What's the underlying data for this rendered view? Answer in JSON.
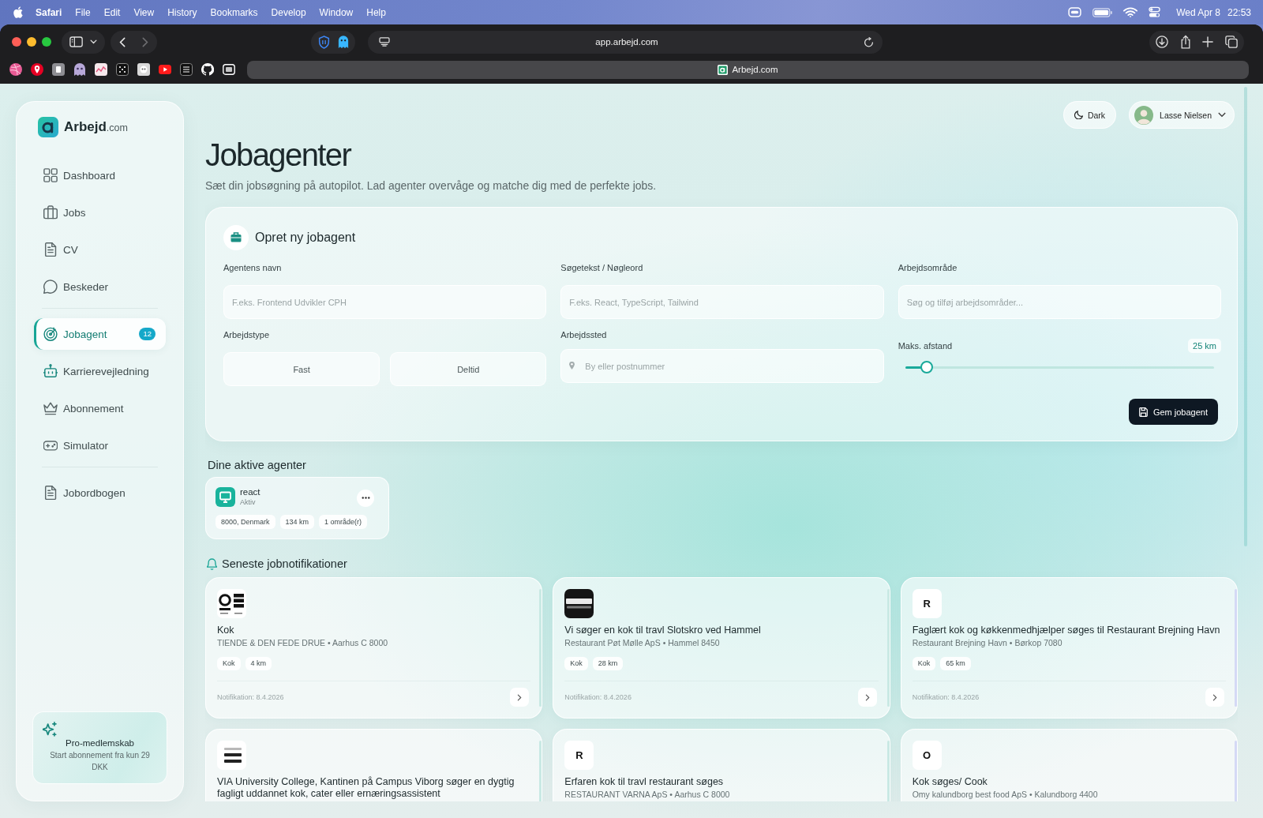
{
  "menu_bar": {
    "app": "Safari",
    "menus": [
      "File",
      "Edit",
      "View",
      "History",
      "Bookmarks",
      "Develop",
      "Window",
      "Help"
    ],
    "date": "Wed Apr 8",
    "time": "22:53"
  },
  "browser": {
    "url": "app.arbejd.com",
    "tab_title": "Arbejd.com"
  },
  "sidebar": {
    "logo": "**Arbejd**.com",
    "sections": [
      {
        "items": [
          {
            "label": "Dashboard",
            "selected": false
          },
          {
            "label": "Jobs",
            "selected": false
          },
          {
            "label": "CV",
            "selected": false
          },
          {
            "label": "Beskeder",
            "selected": false
          }
        ]
      },
      {
        "items": [
          {
            "label": "Jobagent",
            "selected": true,
            "badge": "12"
          },
          {
            "label": "Karrierevejledning",
            "selected": false
          },
          {
            "label": "Abonnement",
            "selected": false
          },
          {
            "label": "Simulator",
            "selected": false
          }
        ]
      },
      {
        "items": [
          {
            "label": "Jobordbogen",
            "selected": false
          }
        ]
      }
    ],
    "promo": {
      "title": "Pro-medlemskab",
      "text": "Start abonnement fra kun 29 DKK"
    }
  },
  "header": {
    "theme_button": "Dark",
    "user_name": "Lasse Nielsen"
  },
  "page": {
    "title": "Jobagenter",
    "subtitle": "Sæt din jobsøgning på autopilot. Lad agenter overvåge og matche dig med de perfekte jobs."
  },
  "form": {
    "title": "Opret ny jobagent",
    "agent_name": {
      "label": "Agentens navn",
      "placeholder": "F.eks. Frontend Udvikler CPH"
    },
    "keywords": {
      "label": "Søgetekst / Nøgleord",
      "placeholder": "F.eks. React, TypeScript, Tailwind"
    },
    "work_area": {
      "label": "Arbejdsområde",
      "placeholder": "Søg og tilføj arbejdsområder..."
    },
    "work_type": {
      "label": "Arbejdstype",
      "options": [
        {
          "label": "Fast",
          "selected": false
        },
        {
          "label": "Deltid",
          "selected": false
        }
      ]
    },
    "location": {
      "label": "Arbejdssted",
      "placeholder": "By eller postnummer"
    },
    "max_distance": {
      "label": "Maks. afstand",
      "reading": "25 km",
      "level": 0.07
    },
    "save_button": "Gem jobagent"
  },
  "active_agents": {
    "title": "Dine aktive agenter",
    "agents": [
      {
        "name": "react",
        "status": "Aktiv",
        "tags": [
          "8000, Denmark",
          "134 km",
          "1 område(r)"
        ]
      }
    ]
  },
  "notifications": {
    "title": "Seneste jobnotifikationer",
    "cards": [
      {
        "logo": {
          "kind": "ring"
        },
        "title": "Kok",
        "company": "TIENDE & DEN FEDE DRUE • Aarhus C 8000",
        "tags": [
          "Kok",
          "4 km"
        ],
        "date": "Notifikation: 8.4.2026",
        "color": "#c9e9e4"
      },
      {
        "logo": {
          "kind": "dark"
        },
        "title": "Vi søger en kok til travl Slotskro ved Hammel",
        "company": "Restaurant Pøt Mølle ApS • Hammel 8450",
        "tags": [
          "Kok",
          "28 km"
        ],
        "date": "Notifikation: 8.4.2026",
        "color": "#c9e9e4"
      },
      {
        "logo": {
          "kind": "letter",
          "text": "R"
        },
        "title": "Faglært kok og køkkenmedhjælper søges til Restaurant Brejning Havn",
        "company": "Restaurant Brejning Havn • Børkop 7080",
        "tags": [
          "Kok",
          "65 km"
        ],
        "date": "Notifikation: 8.4.2026",
        "color": "#d4d9f5"
      },
      {
        "logo": {
          "kind": "plain"
        },
        "title": "VIA University College, Kantinen på Campus Viborg søger en dygtig fagligt uddannet kok, cater eller ernæringsassistent",
        "color": "#c9e9e4"
      },
      {
        "logo": {
          "kind": "letter",
          "text": "R"
        },
        "title": "Erfaren kok til travl restaurant søges",
        "company": "RESTAURANT VARNA ApS • Aarhus C 8000",
        "color": "#c9e9e4"
      },
      {
        "logo": {
          "kind": "letter",
          "text": "O"
        },
        "title": "Kok søges/ Cook",
        "company": "Omy kalundborg best food ApS • Kalundborg 4400",
        "color": "#d4d9f5"
      }
    ]
  }
}
